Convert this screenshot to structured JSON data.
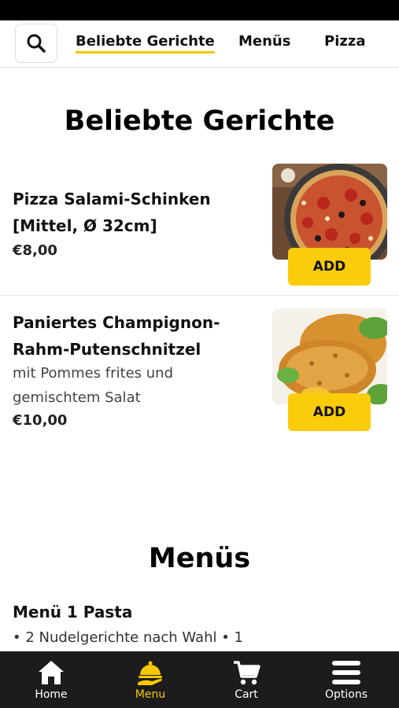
{
  "nav": {
    "tabs": [
      "Beliebte Gerichte",
      "Menüs",
      "Pizza"
    ]
  },
  "sections": {
    "popular_title": "Beliebte Gerichte",
    "menus_title": "Menüs"
  },
  "items": [
    {
      "name_line1": "Pizza Salami-Schinken",
      "name_line2": "[Mittel, Ø 32cm]",
      "price": "€8,00",
      "add_label": "ADD",
      "image": "pizza-photo"
    },
    {
      "name_line1": "Paniertes Champignon-",
      "name_line2": "Rahm-Putenschnitzel",
      "desc_line1": "mit Pommes frites und",
      "desc_line2": "gemischtem Salat",
      "price": "€10,00",
      "add_label": "ADD",
      "image": "schnitzel-photo"
    }
  ],
  "menus": {
    "first_name": "Menü 1 Pasta",
    "first_desc": "• 2 Nudelgerichte nach Wahl • 1"
  },
  "bottom_nav": [
    {
      "label": "Home",
      "icon": "home-icon"
    },
    {
      "label": "Menu",
      "icon": "menu-cloche-icon"
    },
    {
      "label": "Cart",
      "icon": "cart-icon"
    },
    {
      "label": "Options",
      "icon": "hamburger-icon"
    }
  ],
  "colors": {
    "accent": "#fbcc0a",
    "bottom_nav_bg": "#1c1c1c",
    "active_nav": "#f6c800"
  }
}
